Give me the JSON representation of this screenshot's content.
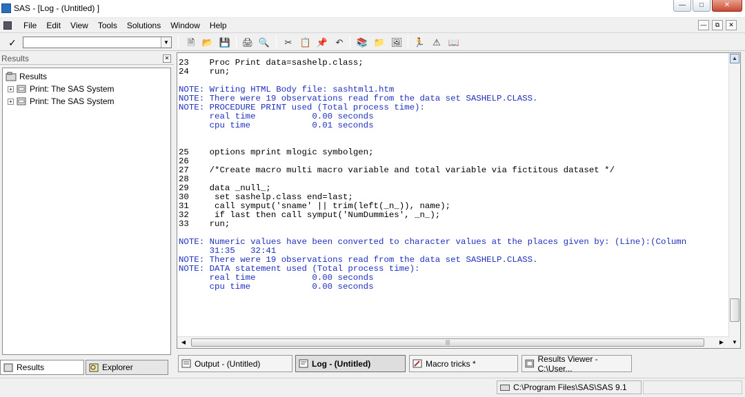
{
  "window": {
    "title": "SAS - [Log - (Untitled) ]"
  },
  "menu": [
    "File",
    "Edit",
    "View",
    "Tools",
    "Solutions",
    "Window",
    "Help"
  ],
  "toolbar": {
    "command_value": ""
  },
  "results": {
    "title": "Results",
    "root_label": "Results",
    "items": [
      "Print:  The SAS System",
      "Print:  The SAS System"
    ]
  },
  "pane_tabs": [
    "Results",
    "Explorer"
  ],
  "log": {
    "lines": [
      {
        "ln": "23",
        "text": "    Proc Print data=sashelp.class;",
        "type": "code"
      },
      {
        "ln": "24",
        "text": "    run;",
        "type": "code"
      },
      {
        "ln": "",
        "text": "",
        "type": "blank"
      },
      {
        "ln": "",
        "text": "NOTE: Writing HTML Body file: sashtml1.htm",
        "type": "note"
      },
      {
        "ln": "",
        "text": "NOTE: There were 19 observations read from the data set SASHELP.CLASS.",
        "type": "note"
      },
      {
        "ln": "",
        "text": "NOTE: PROCEDURE PRINT used (Total process time):",
        "type": "note"
      },
      {
        "ln": "",
        "text": "      real time           0.00 seconds",
        "type": "note"
      },
      {
        "ln": "",
        "text": "      cpu time            0.01 seconds",
        "type": "note"
      },
      {
        "ln": "",
        "text": "",
        "type": "blank"
      },
      {
        "ln": "",
        "text": "",
        "type": "blank"
      },
      {
        "ln": "25",
        "text": "    options mprint mlogic symbolgen;",
        "type": "code"
      },
      {
        "ln": "26",
        "text": "",
        "type": "code"
      },
      {
        "ln": "27",
        "text": "    /*Create macro multi macro variable and total variable via fictitous dataset */",
        "type": "code"
      },
      {
        "ln": "28",
        "text": "",
        "type": "code"
      },
      {
        "ln": "29",
        "text": "    data _null_;",
        "type": "code"
      },
      {
        "ln": "30",
        "text": "     set sashelp.class end=last;",
        "type": "code"
      },
      {
        "ln": "31",
        "text": "     call symput('sname' || trim(left(_n_)), name);",
        "type": "code"
      },
      {
        "ln": "32",
        "text": "     if last then call symput('NumDummies', _n_);",
        "type": "code"
      },
      {
        "ln": "33",
        "text": "    run;",
        "type": "code"
      },
      {
        "ln": "",
        "text": "",
        "type": "blank"
      },
      {
        "ln": "",
        "text": "NOTE: Numeric values have been converted to character values at the places given by: (Line):(Column",
        "type": "note"
      },
      {
        "ln": "",
        "text": "      31:35   32:41",
        "type": "note"
      },
      {
        "ln": "",
        "text": "NOTE: There were 19 observations read from the data set SASHELP.CLASS.",
        "type": "note"
      },
      {
        "ln": "",
        "text": "NOTE: DATA statement used (Total process time):",
        "type": "note"
      },
      {
        "ln": "",
        "text": "      real time           0.00 seconds",
        "type": "note"
      },
      {
        "ln": "",
        "text": "      cpu time            0.00 seconds",
        "type": "note"
      }
    ]
  },
  "window_tabs": [
    {
      "label": "Output - (Untitled)",
      "icon": "output-window-icon"
    },
    {
      "label": "Log - (Untitled)",
      "icon": "log-window-icon"
    },
    {
      "label": "Macro tricks *",
      "icon": "editor-window-icon"
    },
    {
      "label": "Results Viewer - C:\\User...",
      "icon": "results-viewer-icon"
    }
  ],
  "status": {
    "path": "C:\\Program Files\\SAS\\SAS 9.1"
  },
  "colors": {
    "note_text": "#1f2fbf",
    "title_bg": "#ffffff",
    "chrome_bg": "#f0f0f0"
  }
}
